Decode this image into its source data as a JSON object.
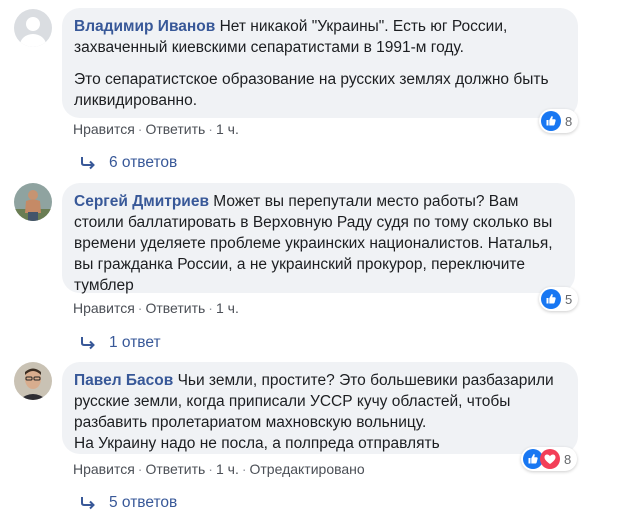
{
  "comments": [
    {
      "author": "Владимир Иванов",
      "text_p1": "Нет никакой \"Украины\". Есть юг России, захваченный киевскими сепаратистами в 1991-м году.",
      "text_p2": "Это сепаратистское образование на русских землях должно быть ликвидированно.",
      "like": "Нравится",
      "reply": "Ответить",
      "time": "1 ч.",
      "reactions": [
        "like-icon"
      ],
      "reaction_count": "8",
      "replies_label": "6 ответов"
    },
    {
      "author": "Сергей Дмитриев",
      "text": "Может вы перепутали место работы? Вам стоили баллатировать в Верховную Раду судя по тому сколько вы времени уделяете проблеме украинских националистов. Наталья, вы гражданка России, а не украинский прокурор, переключите тумблер",
      "like": "Нравится",
      "reply": "Ответить",
      "time": "1 ч.",
      "reactions": [
        "like-icon"
      ],
      "reaction_count": "5",
      "replies_label": "1 ответ"
    },
    {
      "author": "Павел Басов",
      "text_l1": "Чьи земли, простите? Это большевики разбазарили русские земли, когда приписали УССР кучу областей, чтобы разбавить пролетариатом махновскую вольницу.",
      "text_l2": "На Украину надо не посла, а полпреда отправлять",
      "like": "Нравится",
      "reply": "Ответить",
      "time": "1 ч.",
      "edited": "Отредактировано",
      "reactions": [
        "like-icon",
        "love-icon"
      ],
      "reaction_count": "8",
      "replies_label": "5 ответов"
    }
  ],
  "colors": {
    "link": "#385898",
    "bubble": "#f0f2f5",
    "like": "#1877f2",
    "love": "#f33e58"
  }
}
